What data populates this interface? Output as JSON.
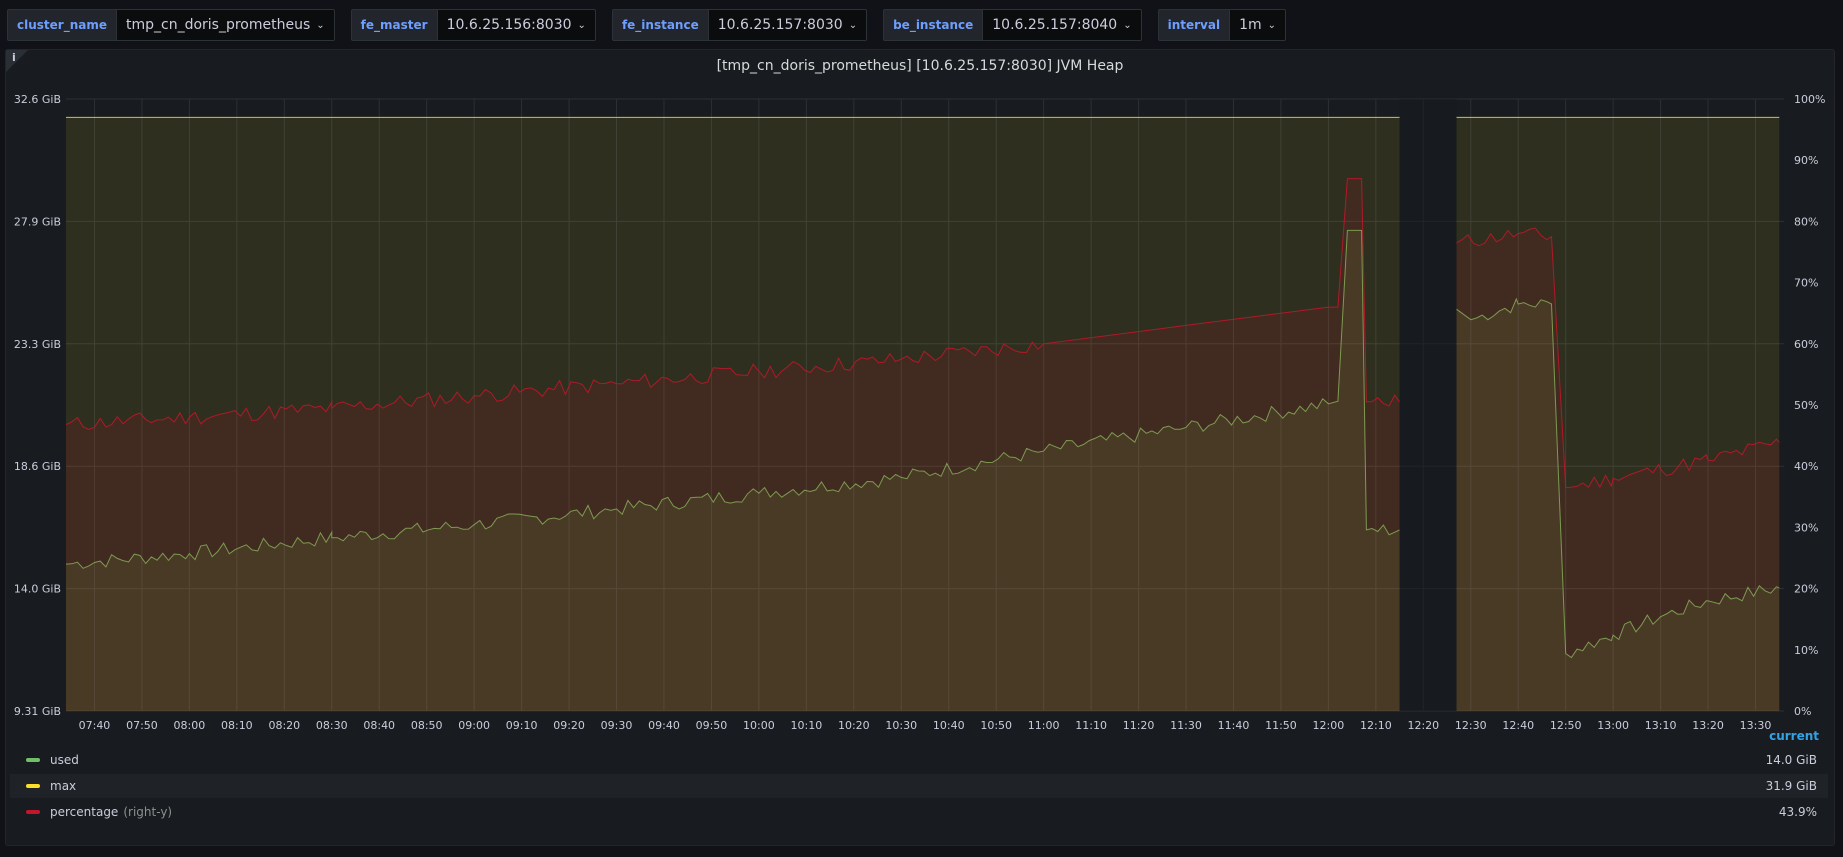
{
  "variables": [
    {
      "label": "cluster_name",
      "value": "tmp_cn_doris_prometheus"
    },
    {
      "label": "fe_master",
      "value": "10.6.25.156:8030"
    },
    {
      "label": "fe_instance",
      "value": "10.6.25.157:8030"
    },
    {
      "label": "be_instance",
      "value": "10.6.25.157:8040"
    },
    {
      "label": "interval",
      "value": "1m"
    }
  ],
  "panel": {
    "title": "[tmp_cn_doris_prometheus] [10.6.25.157:8030] JVM Heap",
    "info_icon": "i"
  },
  "legend": {
    "header": "current",
    "items": [
      {
        "name": "used",
        "hint": "",
        "value": "14.0 GiB",
        "color": "#73bf69"
      },
      {
        "name": "max",
        "hint": "",
        "value": "31.9 GiB",
        "color": "#fade2a"
      },
      {
        "name": "percentage",
        "hint": "(right-y)",
        "value": "43.9%",
        "color": "#c4162a"
      }
    ]
  },
  "chart_data": {
    "type": "line",
    "title": "[tmp_cn_doris_prometheus] [10.6.25.157:8030] JVM Heap",
    "y_left_ticks": [
      "9.31 GiB",
      "14.0 GiB",
      "18.6 GiB",
      "23.3 GiB",
      "27.9 GiB",
      "32.6 GiB"
    ],
    "y_left_range_gib": [
      9.31,
      32.6
    ],
    "y_right_ticks": [
      "0%",
      "10%",
      "20%",
      "30%",
      "40%",
      "50%",
      "60%",
      "70%",
      "80%",
      "90%",
      "100%"
    ],
    "y_right_range_percent": [
      0,
      100
    ],
    "x_ticks": [
      "07:40",
      "07:50",
      "08:00",
      "08:10",
      "08:20",
      "08:30",
      "08:40",
      "08:50",
      "09:00",
      "09:10",
      "09:20",
      "09:30",
      "09:40",
      "09:50",
      "10:00",
      "10:10",
      "10:20",
      "10:30",
      "10:40",
      "10:50",
      "11:00",
      "11:10",
      "11:20",
      "11:30",
      "11:40",
      "11:50",
      "12:00",
      "12:10",
      "12:20",
      "12:30",
      "12:40",
      "12:50",
      "13:00",
      "13:10",
      "13:20",
      "13:30"
    ],
    "x_range": [
      "07:34",
      "13:36"
    ],
    "grid": true,
    "gap": [
      "12:15",
      "12:27"
    ],
    "series": [
      {
        "name": "used",
        "axis": "left",
        "unit": "GiB",
        "color": "#73bf69",
        "points": [
          [
            "07:34",
            14.9
          ],
          [
            "08:00",
            15.3
          ],
          [
            "08:30",
            15.9
          ],
          [
            "09:00",
            16.4
          ],
          [
            "09:30",
            17.0
          ],
          [
            "10:00",
            17.6
          ],
          [
            "10:30",
            18.2
          ],
          [
            "11:00",
            19.2
          ],
          [
            "11:30",
            20.1
          ],
          [
            "12:00",
            21.0
          ],
          [
            "12:02",
            21.1
          ],
          [
            "12:04",
            27.6
          ],
          [
            "12:07",
            27.6
          ],
          [
            "12:08",
            16.2
          ],
          [
            "12:15",
            16.2
          ],
          null,
          [
            "12:27",
            24.6
          ],
          [
            "12:30",
            24.2
          ],
          [
            "12:40",
            24.8
          ],
          [
            "12:47",
            24.8
          ],
          [
            "12:50",
            11.5
          ],
          [
            "13:00",
            12.2
          ],
          [
            "13:10",
            12.9
          ],
          [
            "13:20",
            13.5
          ],
          [
            "13:35",
            14.0
          ]
        ]
      },
      {
        "name": "max",
        "axis": "left",
        "unit": "GiB",
        "color": "#fade2a",
        "points": [
          [
            "07:34",
            31.9
          ],
          [
            "12:15",
            31.9
          ],
          null,
          [
            "12:27",
            31.9
          ],
          [
            "13:35",
            31.9
          ]
        ]
      },
      {
        "name": "percentage",
        "axis": "right",
        "unit": "%",
        "color": "#c4162a",
        "points": [
          [
            "07:34",
            46.8
          ],
          [
            "08:00",
            48.0
          ],
          [
            "08:30",
            49.5
          ],
          [
            "09:00",
            51.5
          ],
          [
            "09:30",
            53.5
          ],
          [
            "10:00",
            55.5
          ],
          [
            "10:30",
            57.5
          ],
          [
            "11:00",
            60.0
          ],
          [
            "11:30",
            63.0
          ],
          [
            "12:00",
            66.0
          ],
          [
            "12:02",
            66.0
          ],
          [
            "12:04",
            87.0
          ],
          [
            "12:07",
            87.0
          ],
          [
            "12:08",
            50.5
          ],
          [
            "12:15",
            50.5
          ],
          null,
          [
            "12:27",
            76.5
          ],
          [
            "12:40",
            78.0
          ],
          [
            "12:47",
            77.5
          ],
          [
            "12:50",
            36.5
          ],
          [
            "13:00",
            38.0
          ],
          [
            "13:10",
            39.5
          ],
          [
            "13:20",
            41.0
          ],
          [
            "13:35",
            43.9
          ]
        ]
      }
    ]
  }
}
